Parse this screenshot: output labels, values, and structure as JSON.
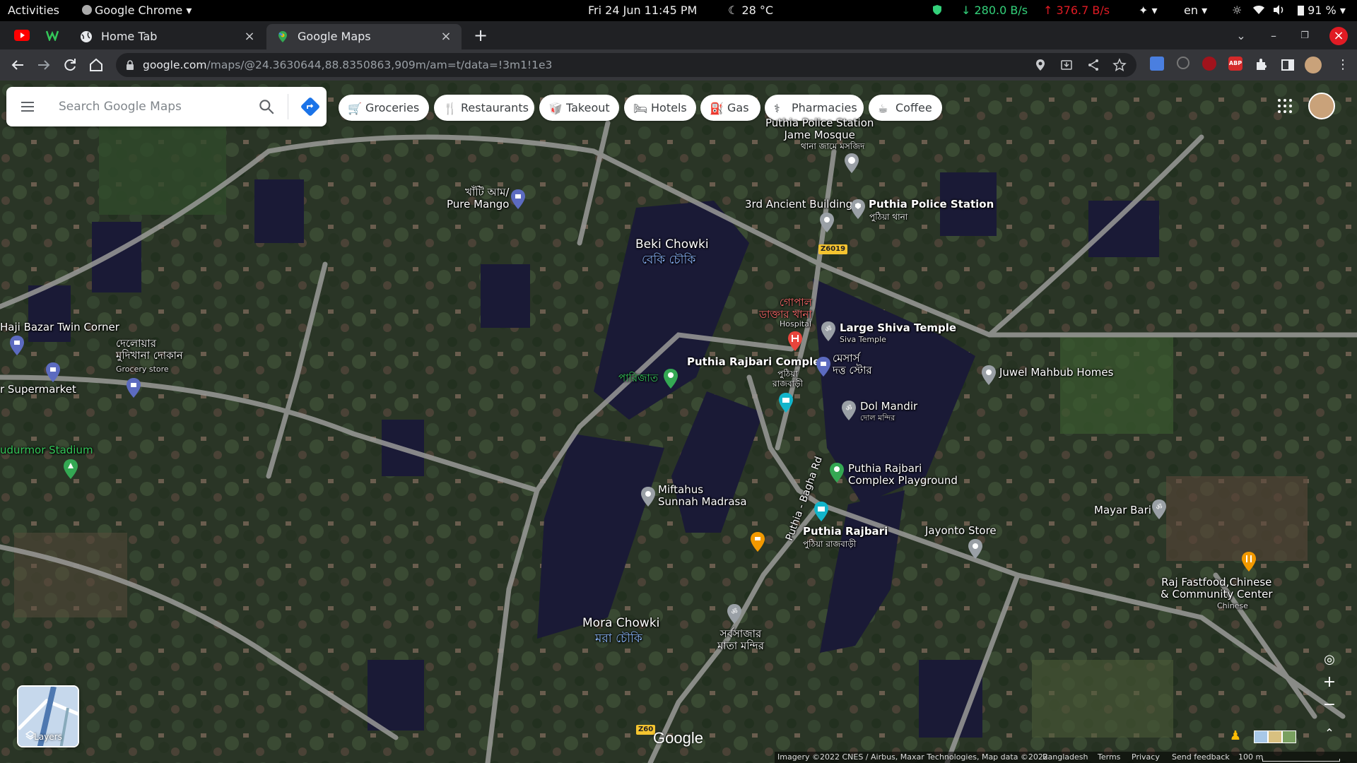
{
  "topbar": {
    "activities": "Activities",
    "app_menu": "Google Chrome",
    "datetime": "Fri 24 Jun  11:45 PM",
    "weather": "28 °C",
    "net_down": "↓ 280.0 B/s",
    "net_up": "↑ 376.7 B/s",
    "lang": "en",
    "battery": "91 %"
  },
  "tabs": [
    {
      "title": "Home Tab",
      "active": false
    },
    {
      "title": "Google Maps",
      "active": true
    }
  ],
  "omnibar": {
    "url_host": "google.com",
    "url_path": "/maps/@24.3630644,88.8350863,909m/am=t/data=!3m1!1e3"
  },
  "search": {
    "placeholder": "Search Google Maps"
  },
  "chips": [
    "Groceries",
    "Restaurants",
    "Takeout",
    "Hotels",
    "Gas",
    "Pharmacies",
    "Coffee"
  ],
  "places": {
    "jame_mosque": "Puthia Police Station\nJame Mosque",
    "jame_mosque_bn": "থানা জামে মসজিদ",
    "pure_mango": "খাঁটি আম/\nPure Mango",
    "ancient_building": "3rd Ancient Building",
    "police_station": "Puthia Police Station",
    "police_station_bn": "পুঠিয়া থানা",
    "beki_chowki": "Beki Chowki",
    "beki_chowki_bn": "বেকি চৌকি",
    "hospital_bn": "গোপাল\nডাক্তার খানা",
    "hospital": "Hospital",
    "large_shiva": "Large Shiva Temple",
    "siva_temple": "Siva Temple",
    "rajbari_complex": "Puthia Rajbari Complex",
    "rajbari_complex_bn": "পুঠিয়া\nরাজবাড়ী",
    "messrs": "মেসার্স\nদত্ত স্টোর",
    "parijat": "পারিজাত",
    "juwel": "Juwel Mahbub Homes",
    "dol_mandir": "Dol Mandir",
    "dol_mandir_bn": "দোল মন্দির",
    "haji_bazar": "Haji Bazar Twin Corner",
    "dulowar": "দেলোয়ার\nমুদিখানা দোকান",
    "grocery_store": "Grocery store",
    "supermarket": "r Supermarket",
    "stadium": "udurmor Stadium",
    "miftahus": "Miftahus\nSunnah Madrasa",
    "playground": "Puthia Rajbari\nComplex Playground",
    "rajbari": "Puthia Rajbari",
    "rajbari_bn": "পুঠিয়া রাজবাড়ী",
    "jayonto": "Jayonto Store",
    "mayar_bari": "Mayar Bari",
    "raj_fastfood": "Raj Fastfood,Chinese\n& Community Center",
    "chinese": "Chinese",
    "mora_chowki": "Mora Chowki",
    "mora_chowki_bn": "মরা চৌকি",
    "sarbasajar": "সর্বসাজার\nমাতা মন্দির",
    "road_name": "Puthia - Bagha Rd",
    "road_sign_1": "Z6019",
    "road_sign_2": "Z60"
  },
  "map": {
    "layers": "Layers",
    "google": "Google",
    "attribution": "Imagery ©2022 CNES / Airbus, Maxar Technologies, Map data ©2022",
    "country": "Bangladesh",
    "terms": "Terms",
    "privacy": "Privacy",
    "feedback": "Send feedback",
    "scale": "100 m"
  }
}
